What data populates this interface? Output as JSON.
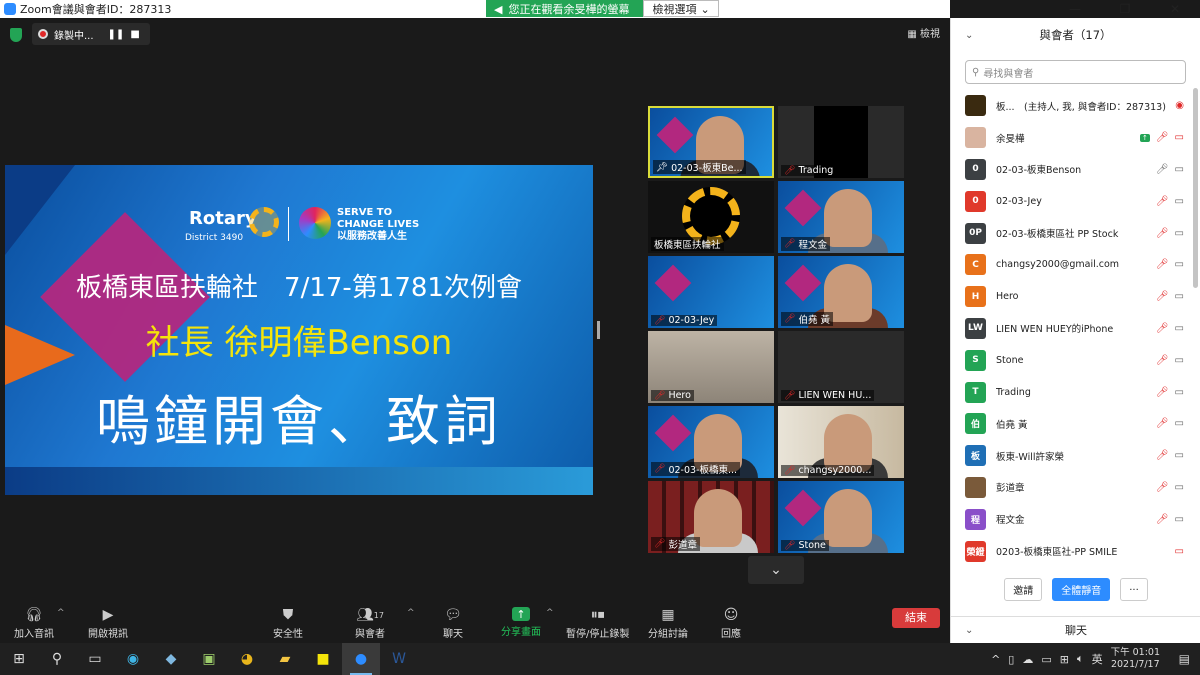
{
  "window": {
    "title": "Zoom會議與會者ID：287313"
  },
  "share_banner": {
    "message": "您正在觀看余旻樺的螢幕",
    "options_label": "檢視選項"
  },
  "recording": {
    "label": "錄製中..."
  },
  "view_button": {
    "label": "檢視"
  },
  "slide": {
    "rotary": "Rotary",
    "district": "District 3490",
    "serve_line1": "SERVE TO",
    "serve_line2": "CHANGE LIVES",
    "serve_line3": "以服務改善人生",
    "line1": "板橋東區扶輪社　7/17-第1781次例會",
    "line2": "社長 徐明偉Benson",
    "line3": "鳴鐘開會、致詞"
  },
  "tiles": [
    {
      "name": "02-03-板東Be...",
      "muted": false,
      "pinned": true,
      "kind": "slide-person",
      "active": true
    },
    {
      "name": "Trading",
      "muted": true,
      "kind": "dark"
    },
    {
      "name": "板橋東區扶輪社",
      "muted": false,
      "kind": "logo"
    },
    {
      "name": "程文金",
      "muted": true,
      "kind": "slide-person"
    },
    {
      "name": "02-03-Jey",
      "muted": true,
      "kind": "slide"
    },
    {
      "name": "伯堯 黃",
      "muted": true,
      "kind": "slide-person"
    },
    {
      "name": "Hero",
      "muted": true,
      "kind": "room"
    },
    {
      "name": "LIEN WEN HU...",
      "muted": true,
      "kind": "dark"
    },
    {
      "name": "02-03-板橋東...",
      "muted": true,
      "kind": "slide-person"
    },
    {
      "name": "changsy2000...",
      "muted": true,
      "kind": "room-person"
    },
    {
      "name": "彭道章",
      "muted": true,
      "kind": "shelf-person"
    },
    {
      "name": "Stone",
      "muted": true,
      "kind": "slide-person"
    }
  ],
  "toolbar": {
    "audio": "加入音訊",
    "video": "開啟視訊",
    "security": "安全性",
    "participants": "與會者",
    "participants_count": "17",
    "chat": "聊天",
    "share": "分享畫面",
    "record": "暫停/停止錄製",
    "breakout": "分組討論",
    "reactions": "回應",
    "end": "結束"
  },
  "panel": {
    "title": "與會者（17）",
    "search_placeholder": "尋找與會者",
    "participants": [
      {
        "avatar": "",
        "avatar_color": "#3a2a10",
        "name": "板...　(主持人, 我, 與會者ID：287313)",
        "icons": "host"
      },
      {
        "avatar": "",
        "avatar_color": "#d9b4a0",
        "name": "余旻樺",
        "icons": "share"
      },
      {
        "avatar": "0",
        "avatar_color": "#3c4043",
        "name": "02-03-板東Benson",
        "icons": "mic-on"
      },
      {
        "avatar": "0",
        "avatar_color": "#e0392b",
        "name": "02-03-Jey",
        "icons": "muted"
      },
      {
        "avatar": "0P",
        "avatar_color": "#3c4043",
        "name": "02-03-板橋東區社 PP Stock",
        "icons": "muted"
      },
      {
        "avatar": "C",
        "avatar_color": "#e8711a",
        "name": "changsy2000@gmail.com",
        "icons": "muted"
      },
      {
        "avatar": "H",
        "avatar_color": "#e8711a",
        "name": "Hero",
        "icons": "muted"
      },
      {
        "avatar": "LW",
        "avatar_color": "#3c4043",
        "name": "LIEN WEN HUEY的iPhone",
        "icons": "muted"
      },
      {
        "avatar": "S",
        "avatar_color": "#23a455",
        "name": "Stone",
        "icons": "muted"
      },
      {
        "avatar": "T",
        "avatar_color": "#23a455",
        "name": "Trading",
        "icons": "muted"
      },
      {
        "avatar": "伯",
        "avatar_color": "#23a455",
        "name": "伯堯 黃",
        "icons": "muted"
      },
      {
        "avatar": "板",
        "avatar_color": "#1f6fb5",
        "name": "板東-Will許家榮",
        "icons": "muted"
      },
      {
        "avatar": "",
        "avatar_color": "#7a5a3a",
        "name": "彭道章",
        "icons": "muted"
      },
      {
        "avatar": "程",
        "avatar_color": "#8a4fc9",
        "name": "程文金",
        "icons": "muted"
      },
      {
        "avatar": "榮鐙",
        "avatar_color": "#e0392b",
        "name": "0203-板橋東區社-PP SMILE",
        "icons": "cam-only"
      }
    ],
    "invite": "邀請",
    "mute_all": "全體靜音",
    "more": "...",
    "chat_title": "聊天"
  },
  "taskbar": {
    "time": "下午 01:01",
    "date": "2021/7/17"
  }
}
